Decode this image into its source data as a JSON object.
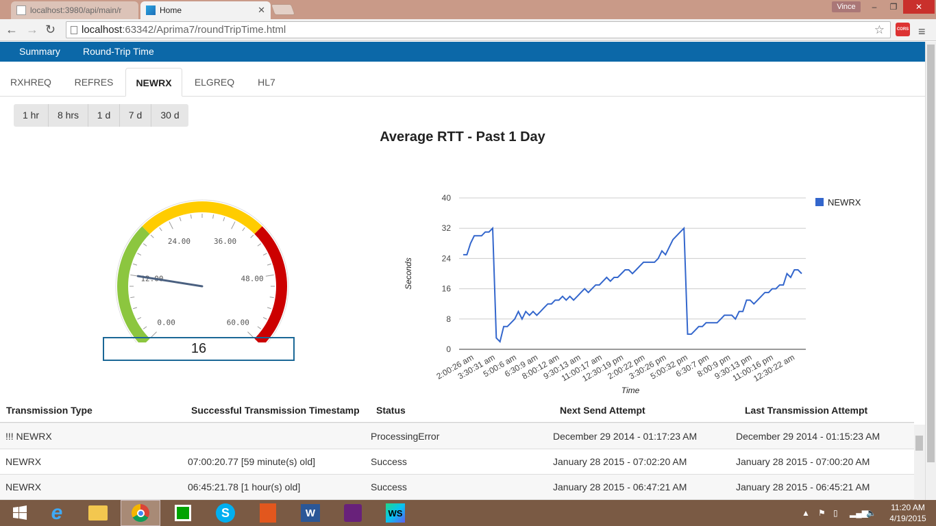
{
  "browser": {
    "tabs": [
      {
        "title": "localhost:3980/api/main/r",
        "active": false
      },
      {
        "title": "Home",
        "active": true
      }
    ],
    "user": "Vince",
    "window_controls": [
      "–",
      "❐",
      "✕"
    ],
    "url_host": "localhost",
    "url_path": ":63342/Aprima7/roundTripTime.html",
    "cors_badge": "CORS"
  },
  "navbar": {
    "items": [
      "Summary",
      "Round-Trip Time"
    ]
  },
  "transmission_tabs": {
    "items": [
      "RXHREQ",
      "REFRES",
      "NEWRX",
      "ELGREQ",
      "HL7"
    ],
    "active": "NEWRX"
  },
  "time_ranges": [
    "1 hr",
    "8 hrs",
    "1 d",
    "7 d",
    "30 d"
  ],
  "title": "Average RTT - Past 1 Day",
  "gauge": {
    "value": 16,
    "display": "16",
    "min": 0,
    "max": 60,
    "tick_labels": [
      "0.00",
      "12.00",
      "24.00",
      "36.00",
      "48.00",
      "60.00"
    ],
    "needle_value": 12,
    "band_colors": {
      "low": "#8cc63f",
      "mid": "#ffcc00",
      "high": "#cc0000"
    },
    "bands": [
      [
        0,
        20
      ],
      [
        20,
        40
      ],
      [
        40,
        60
      ]
    ]
  },
  "chart_data": {
    "type": "line",
    "xlabel": "Time",
    "ylabel": "Seconds",
    "ylim": [
      0,
      40
    ],
    "yticks": [
      "0",
      "8",
      "16",
      "24",
      "32",
      "40"
    ],
    "xticks": [
      "2:00:26 am",
      "3:30:31 am",
      "5:00:6 am",
      "6:30:9 am",
      "8:00:12 am",
      "9:30:13 am",
      "11:00:17 am",
      "12:30:19 pm",
      "2:00:22 pm",
      "3:30:26 pm",
      "5:00:32 pm",
      "6:30:7 pm",
      "8:00:9 pm",
      "9:30:13 pm",
      "11:00:16 pm",
      "12:30:22 am"
    ],
    "legend_position": "right",
    "series": [
      {
        "name": "NEWRX",
        "color": "#3366cc",
        "values": [
          25,
          25,
          28,
          30,
          30,
          30,
          31,
          31,
          32,
          3,
          2,
          6,
          6,
          7,
          8,
          10,
          8,
          10,
          9,
          10,
          9,
          10,
          11,
          12,
          12,
          13,
          13,
          14,
          13,
          14,
          13,
          14,
          15,
          16,
          15,
          16,
          17,
          17,
          18,
          19,
          18,
          19,
          19,
          20,
          21,
          21,
          20,
          21,
          22,
          23,
          23,
          23,
          23,
          24,
          26,
          25,
          27,
          29,
          30,
          31,
          32,
          4,
          4,
          5,
          6,
          6,
          7,
          7,
          7,
          7,
          8,
          9,
          9,
          9,
          8,
          10,
          10,
          13,
          13,
          12,
          13,
          14,
          15,
          15,
          16,
          16,
          17,
          17,
          20,
          19,
          21,
          21,
          20
        ]
      }
    ],
    "grid": true
  },
  "table": {
    "headers": [
      "Transmission Type",
      "Successful Transmission Timestamp",
      "Status",
      "Next Send Attempt",
      "Last Transmission Attempt"
    ],
    "rows": [
      [
        "!!! NEWRX",
        "",
        "ProcessingError",
        "December 29 2014 - 01:17:23 AM",
        "December 29 2014 - 01:15:23 AM"
      ],
      [
        "NEWRX",
        "07:00:20.77 [59 minute(s) old]",
        "Success",
        "January 28 2015 - 07:02:20 AM",
        "January 28 2015 - 07:00:20 AM"
      ],
      [
        "NEWRX",
        "06:45:21.78 [1 hour(s) old]",
        "Success",
        "January 28 2015 - 06:47:21 AM",
        "January 28 2015 - 06:45:21 AM"
      ]
    ]
  },
  "taskbar": {
    "apps": [
      "start-icon",
      "ie-icon",
      "file-explorer-icon",
      "chrome-icon",
      "store-icon",
      "skype-icon",
      "office-icon",
      "word-icon",
      "visual-studio-icon",
      "webstorm-icon"
    ],
    "time": "11:20 AM",
    "date": "4/19/2015"
  }
}
